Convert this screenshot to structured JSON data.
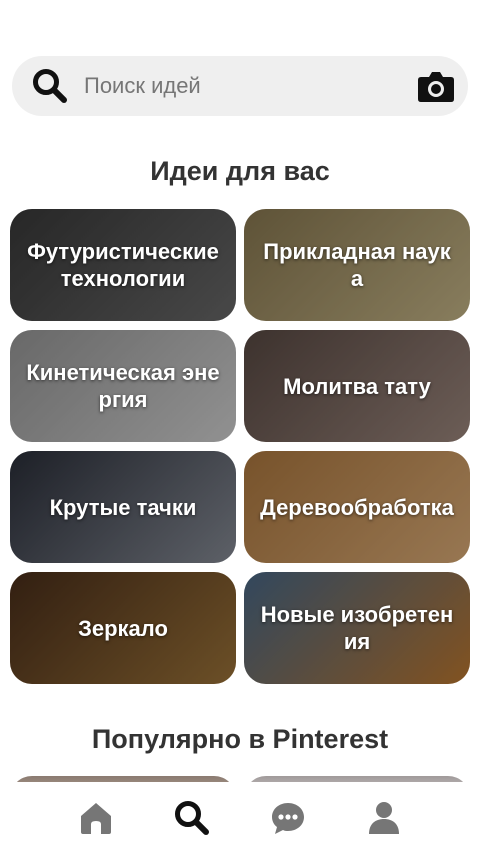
{
  "search": {
    "placeholder": "Поиск идей",
    "search_icon": "search-icon",
    "camera_icon": "camera-icon"
  },
  "ideas_section": {
    "title": "Идеи для вас",
    "tiles": [
      {
        "label": "Футуристические технологии",
        "colors": [
          "#3a3a3a",
          "#6b6b6b"
        ]
      },
      {
        "label": "Прикладная наука",
        "colors": [
          "#8b7a52",
          "#c9b98a"
        ]
      },
      {
        "label": "Кинетическая энергия",
        "colors": [
          "#9a9a9a",
          "#d6d6d6"
        ]
      },
      {
        "label": "Молитва тату",
        "colors": [
          "#5a4a44",
          "#a08a80"
        ]
      },
      {
        "label": "Крутые тачки",
        "colors": [
          "#2b2f3a",
          "#8a8f99"
        ]
      },
      {
        "label": "Деревообработка",
        "colors": [
          "#b07a40",
          "#e0b07a"
        ]
      },
      {
        "label": "Зеркало",
        "colors": [
          "#4a2e1a",
          "#a0763a"
        ]
      },
      {
        "label": "Новые изобретения",
        "colors": [
          "#4a6a8a",
          "#c07a30"
        ]
      }
    ]
  },
  "popular_section": {
    "title": "Популярно в Pinterest"
  },
  "bottom_nav": {
    "items": [
      {
        "name": "home",
        "icon": "home-icon"
      },
      {
        "name": "search",
        "icon": "search-icon",
        "active": true
      },
      {
        "name": "messages",
        "icon": "chat-icon"
      },
      {
        "name": "profile",
        "icon": "profile-icon"
      }
    ]
  },
  "colors": {
    "icon_active": "#111111",
    "icon_inactive": "#767676",
    "search_bg": "#efefef"
  }
}
